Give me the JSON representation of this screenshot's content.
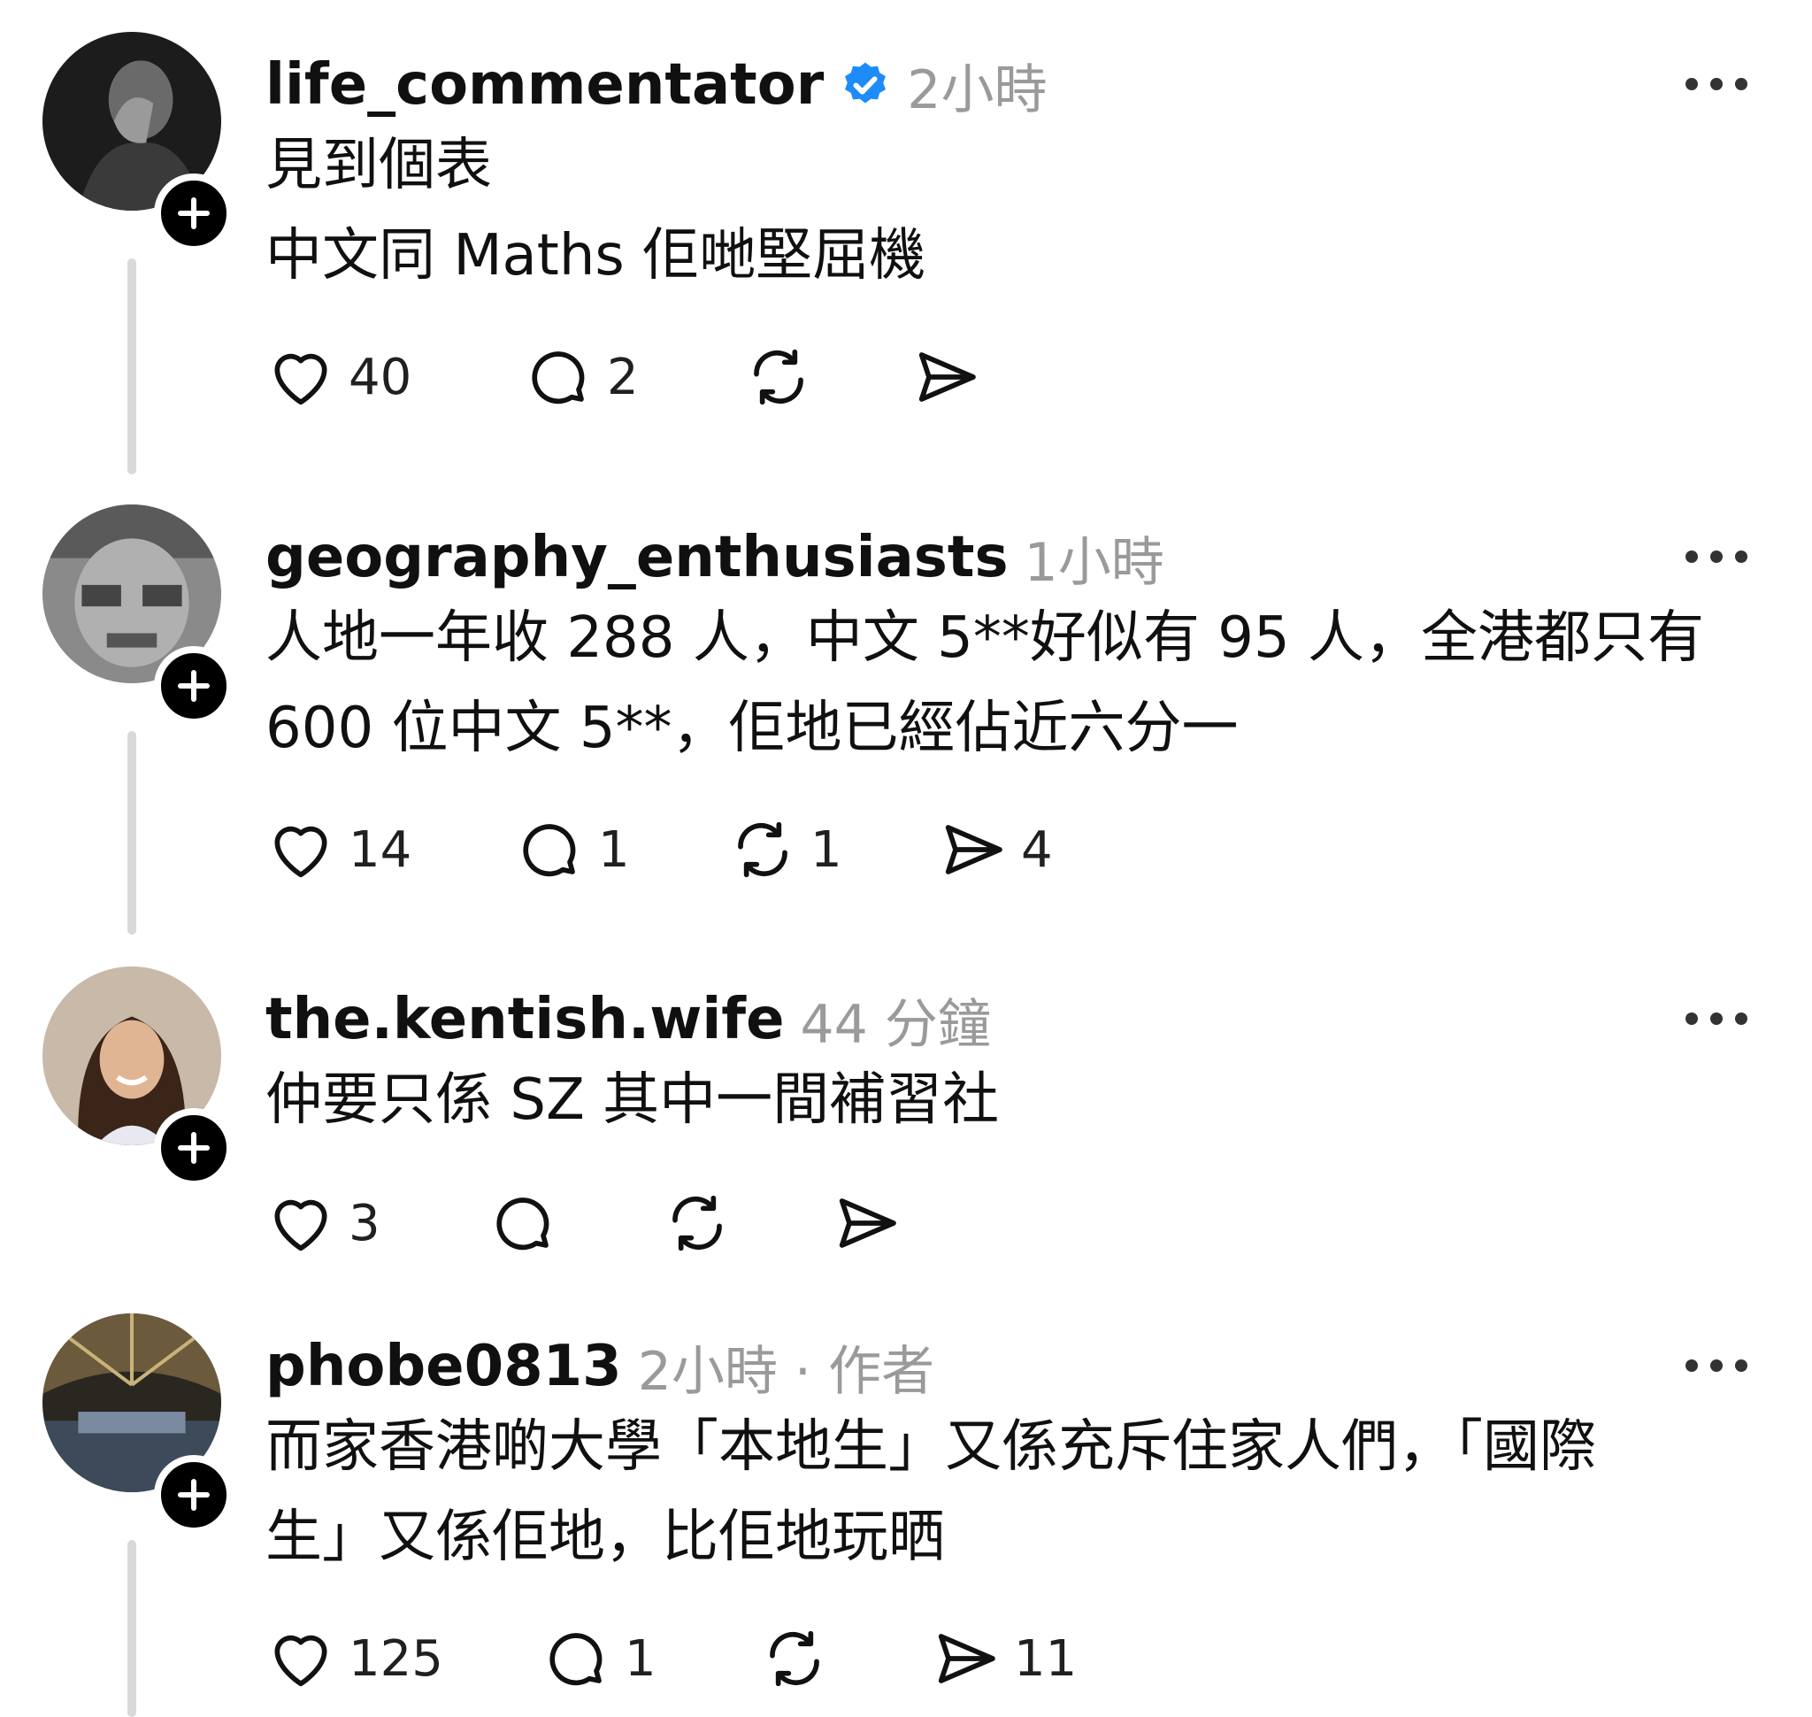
{
  "posts": [
    {
      "username": "life_commentator",
      "verified": true,
      "meta": "2小時",
      "lines": [
        "見到個表",
        "中文同 Maths 佢哋堅屈機"
      ],
      "likes": "40",
      "replies": "2",
      "reposts": "",
      "shares": ""
    },
    {
      "username": "geography_enthusiasts",
      "verified": false,
      "meta": "1小時",
      "lines": [
        "人地一年收 288 人，中文 5**好似有 95 人，全港都只有",
        "600 位中文 5**，佢地已經佔近六分一"
      ],
      "likes": "14",
      "replies": "1",
      "reposts": "1",
      "shares": "4"
    },
    {
      "username": "the.kentish.wife",
      "verified": false,
      "meta": "44 分鐘",
      "lines": [
        "仲要只係 SZ 其中一間補習社"
      ],
      "likes": "3",
      "replies": "",
      "reposts": "",
      "shares": ""
    },
    {
      "username": "phobe0813",
      "verified": false,
      "meta": "2小時 · 作者",
      "lines": [
        "而家香港啲大學「本地生」又係充斥住家人們，「國際",
        "生」又係佢地，比佢地玩晒"
      ],
      "likes": "125",
      "replies": "1",
      "reposts": "",
      "shares": "11"
    }
  ],
  "colors": {
    "text": "#101010",
    "meta": "#9a9a9a",
    "verified": "#1d8cf8",
    "thread_line": "#d9d9d9"
  },
  "icons": [
    "heart-icon",
    "comment-icon",
    "repost-icon",
    "share-icon",
    "more-icon",
    "verified-icon",
    "plus-icon"
  ]
}
